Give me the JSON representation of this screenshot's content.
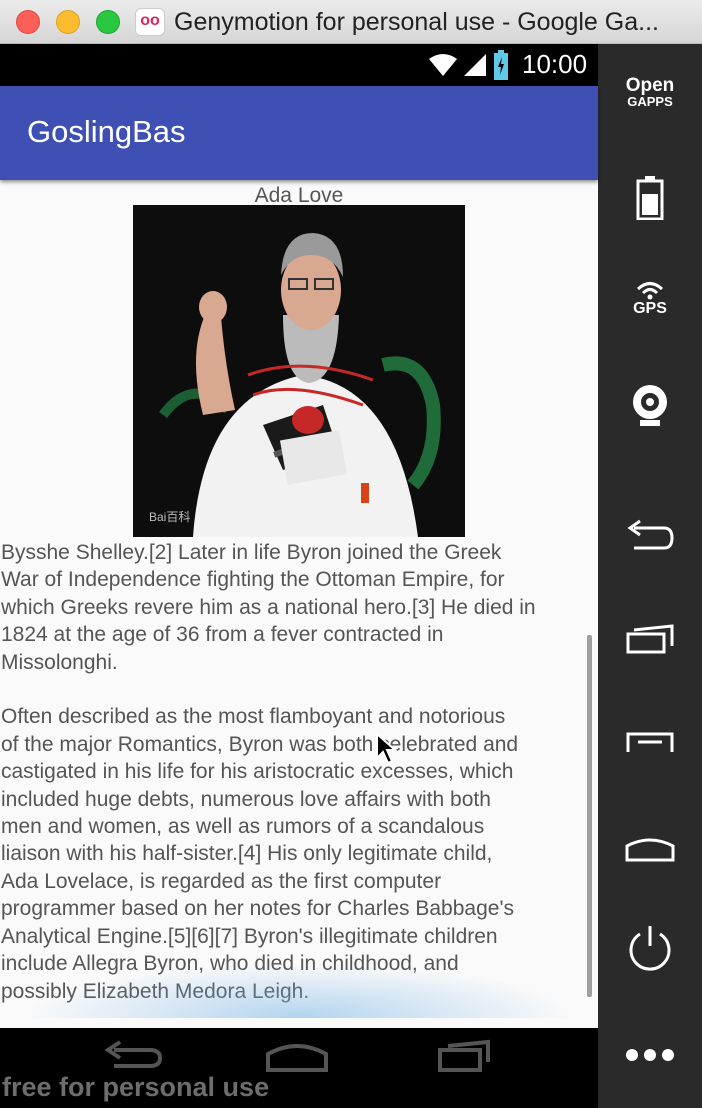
{
  "window": {
    "title": "Genymotion for personal use - Google Ga...",
    "app_icon_text": "oo"
  },
  "statusbar": {
    "time": "10:00"
  },
  "app": {
    "title": "GoslingBas"
  },
  "content": {
    "image_caption": "Ada Love",
    "photo_watermark": "Bai百科",
    "article_text": "Bysshe Shelley.[2] Later in life Byron joined the Greek\nWar of Independence fighting the Ottoman Empire, for\nwhich Greeks revere him as a national hero.[3] He died in\n1824 at the age of 36 from a fever contracted in\nMissolonghi.\n\nOften described as the most flamboyant and notorious\nof the major Romantics, Byron was both celebrated and\ncastigated in his life for his aristocratic excesses, which\nincluded huge debts, numerous love affairs with both\nmen and women, as well as rumors of a scandalous\nliaison with his half-sister.[4] His only legitimate child,\nAda Lovelace, is regarded as the first computer\nprogrammer based on her notes for Charles Babbage's\nAnalytical Engine.[5][6][7] Byron's illegitimate children\ninclude Allegra Byron, who died in childhood, and\npossibly Elizabeth Medora Leigh."
  },
  "watermark": "free for personal use",
  "sidebar": {
    "opengapps_line1": "Open",
    "opengapps_line2": "GAPPS",
    "gps_label": "GPS",
    "items": [
      "battery-icon",
      "gps-icon",
      "webcam-icon",
      "back-icon",
      "recent-apps-icon",
      "menu-icon",
      "home-icon",
      "power-icon",
      "more-icon"
    ]
  },
  "colors": {
    "appbar": "#3e50b4",
    "content_bg": "#fafafa",
    "body_text": "#555555",
    "statusbar": "#000000",
    "sidebar": "#2a2a2a"
  }
}
